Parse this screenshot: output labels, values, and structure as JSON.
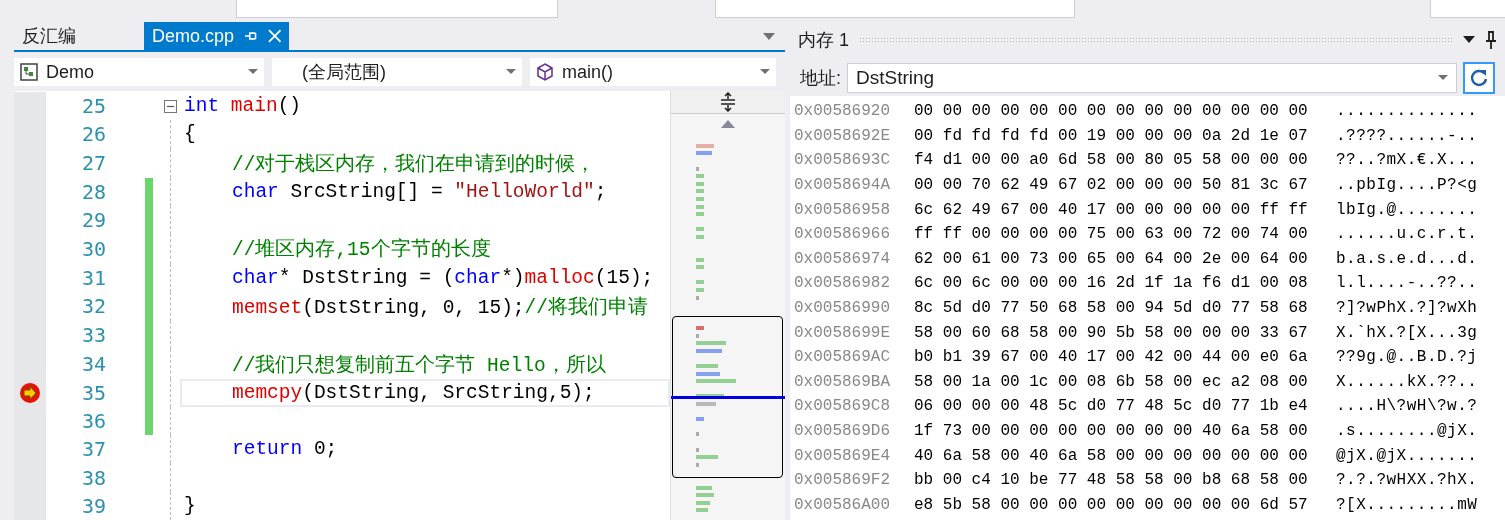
{
  "editor": {
    "tabs": [
      {
        "label": "反汇编",
        "selected": false
      },
      {
        "label": "Demo.cpp",
        "selected": true
      }
    ],
    "nav": [
      {
        "kind": "project",
        "text": "Demo"
      },
      {
        "kind": "scope",
        "text": "(全局范围)"
      },
      {
        "kind": "member",
        "text": "main()"
      }
    ],
    "lines": [
      {
        "number": "25",
        "collapsible": true,
        "changed": false,
        "current": false,
        "indented": false,
        "tokens": [
          {
            "kind": "kw",
            "s": "int"
          },
          {
            "kind": "fn",
            "s": " main"
          },
          {
            "kind": "p",
            "s": "()"
          }
        ]
      },
      {
        "number": "26",
        "collapsible": false,
        "changed": false,
        "current": false,
        "indented": false,
        "tokens": [
          {
            "kind": "p",
            "s": "{"
          }
        ]
      },
      {
        "number": "27",
        "collapsible": false,
        "changed": false,
        "current": false,
        "indented": true,
        "tokens": [
          {
            "kind": "cm",
            "s": "//对于栈区内存，我们在申请到的时候，"
          }
        ]
      },
      {
        "number": "28",
        "collapsible": false,
        "changed": true,
        "current": false,
        "indented": true,
        "tokens": [
          {
            "kind": "kw",
            "s": "char"
          },
          {
            "kind": "p",
            "s": " SrcString[] = "
          },
          {
            "kind": "str",
            "s": "\"HelloWorld\""
          },
          {
            "kind": "p",
            "s": ";"
          }
        ]
      },
      {
        "number": "29",
        "collapsible": false,
        "changed": true,
        "current": false
      },
      {
        "number": "30",
        "collapsible": false,
        "changed": true,
        "current": false,
        "indented": true,
        "tokens": [
          {
            "kind": "cm",
            "s": "//堆区内存,15个字节的长度"
          }
        ]
      },
      {
        "number": "31",
        "collapsible": false,
        "changed": true,
        "current": false,
        "indented": true,
        "tokens": [
          {
            "kind": "kw",
            "s": "char"
          },
          {
            "kind": "p",
            "s": "* DstString = ("
          },
          {
            "kind": "kw",
            "s": "char"
          },
          {
            "kind": "p",
            "s": "*)"
          },
          {
            "kind": "fn",
            "s": "malloc"
          },
          {
            "kind": "p",
            "s": "(15);"
          }
        ]
      },
      {
        "number": "32",
        "collapsible": false,
        "changed": true,
        "current": false,
        "indented": true,
        "tokens": [
          {
            "kind": "fn",
            "s": "memset"
          },
          {
            "kind": "p",
            "s": "(DstString, 0, 15);"
          },
          {
            "kind": "cm",
            "s": "//将我们申请"
          }
        ]
      },
      {
        "number": "33",
        "collapsible": false,
        "changed": true,
        "current": false
      },
      {
        "number": "34",
        "collapsible": false,
        "changed": true,
        "current": false,
        "indented": true,
        "tokens": [
          {
            "kind": "cm",
            "s": "//我们只想复制前五个字节 Hello，所以"
          }
        ]
      },
      {
        "number": "35",
        "collapsible": false,
        "changed": true,
        "current": true,
        "indented": true,
        "tokens": [
          {
            "kind": "fn",
            "s": "memcpy"
          },
          {
            "kind": "p",
            "s": "(DstString, SrcString,5);"
          }
        ]
      },
      {
        "number": "36",
        "collapsible": false,
        "changed": true,
        "current": false
      },
      {
        "number": "37",
        "collapsible": false,
        "changed": false,
        "current": false,
        "indented": true,
        "tokens": [
          {
            "kind": "kw",
            "s": "return"
          },
          {
            "kind": "p",
            "s": " 0;"
          }
        ]
      },
      {
        "number": "38",
        "collapsible": false,
        "changed": false,
        "current": false
      },
      {
        "number": "39",
        "collapsible": false,
        "changed": false,
        "current": false,
        "indented": false,
        "tokens": [
          {
            "kind": "p",
            "s": "}"
          }
        ]
      }
    ]
  },
  "memory": {
    "title": "内存 1",
    "address_label": "地址:",
    "address": "DstString",
    "rows": [
      {
        "address": "0x00586920",
        "bytes": "00 00 00 00 00 00 00 00 00 00 00 00 00 00",
        "ascii": ".............."
      },
      {
        "address": "0x0058692E",
        "bytes": "00 fd fd fd fd 00 19 00 00 00 0a 2d 1e 07",
        "ascii": ".????......-.."
      },
      {
        "address": "0x0058693C",
        "bytes": "f4 d1 00 00 a0 6d 58 00 80 05 58 00 00 00",
        "ascii": "??..?mX.€.X..."
      },
      {
        "address": "0x0058694A",
        "bytes": "00 00 70 62 49 67 02 00 00 00 50 81 3c 67",
        "ascii": "..pbIg....P?<g"
      },
      {
        "address": "0x00586958",
        "bytes": "6c 62 49 67 00 40 17 00 00 00 00 00 ff ff",
        "ascii": "lbIg.@........"
      },
      {
        "address": "0x00586966",
        "bytes": "ff ff 00 00 00 00 75 00 63 00 72 00 74 00",
        "ascii": "......u.c.r.t."
      },
      {
        "address": "0x00586974",
        "bytes": "62 00 61 00 73 00 65 00 64 00 2e 00 64 00",
        "ascii": "b.a.s.e.d...d."
      },
      {
        "address": "0x00586982",
        "bytes": "6c 00 6c 00 00 00 16 2d 1f 1a f6 d1 00 08",
        "ascii": "l.l....-..??.."
      },
      {
        "address": "0x00586990",
        "bytes": "8c 5d d0 77 50 68 58 00 94 5d d0 77 58 68",
        "ascii": "?]?wPhX.?]?wXh"
      },
      {
        "address": "0x0058699E",
        "bytes": "58 00 60 68 58 00 90 5b 58 00 00 00 33 67",
        "ascii": "X.`hX.?[X...3g"
      },
      {
        "address": "0x005869AC",
        "bytes": "b0 b1 39 67 00 40 17 00 42 00 44 00 e0 6a",
        "ascii": "??9g.@..B.D.?j"
      },
      {
        "address": "0x005869BA",
        "bytes": "58 00 1a 00 1c 00 08 6b 58 00 ec a2 08 00",
        "ascii": "X......kX.??.."
      },
      {
        "address": "0x005869C8",
        "bytes": "06 00 00 00 48 5c d0 77 48 5c d0 77 1b e4",
        "ascii": "....H\\?wH\\?w.?"
      },
      {
        "address": "0x005869D6",
        "bytes": "1f 73 00 00 00 00 00 00 00 00 40 6a 58 00",
        "ascii": ".s........@jX."
      },
      {
        "address": "0x005869E4",
        "bytes": "40 6a 58 00 40 6a 58 00 00 00 00 00 00 00",
        "ascii": "@jX.@jX......."
      },
      {
        "address": "0x005869F2",
        "bytes": "bb 00 c4 10 be 77 48 58 58 00 b8 68 58 00",
        "ascii": "?.?.?wHXX.?hX."
      },
      {
        "address": "0x00586A00",
        "bytes": "e8 5b 58 00 00 00 00 00 00 00 00 00 6d 57",
        "ascii": "?[X.........mW"
      }
    ]
  }
}
